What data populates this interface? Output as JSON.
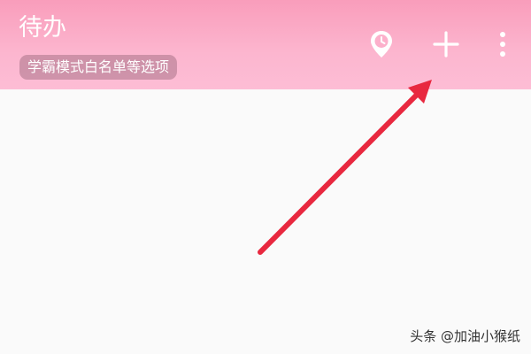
{
  "header": {
    "title": "待办",
    "whitelist_chip": "学霸模式白名单等选项",
    "actions": {
      "timer_icon": "timer-pin-icon",
      "add_icon": "plus-icon",
      "more_icon": "more-vertical-icon"
    }
  },
  "annotation": {
    "arrow_color": "#e8283f"
  },
  "watermark": {
    "text": "头条 @加油小猴纸"
  },
  "colors": {
    "app_bar_top": "#f99dbb",
    "app_bar_bottom": "#fdbdd5",
    "background": "#fafafa"
  }
}
